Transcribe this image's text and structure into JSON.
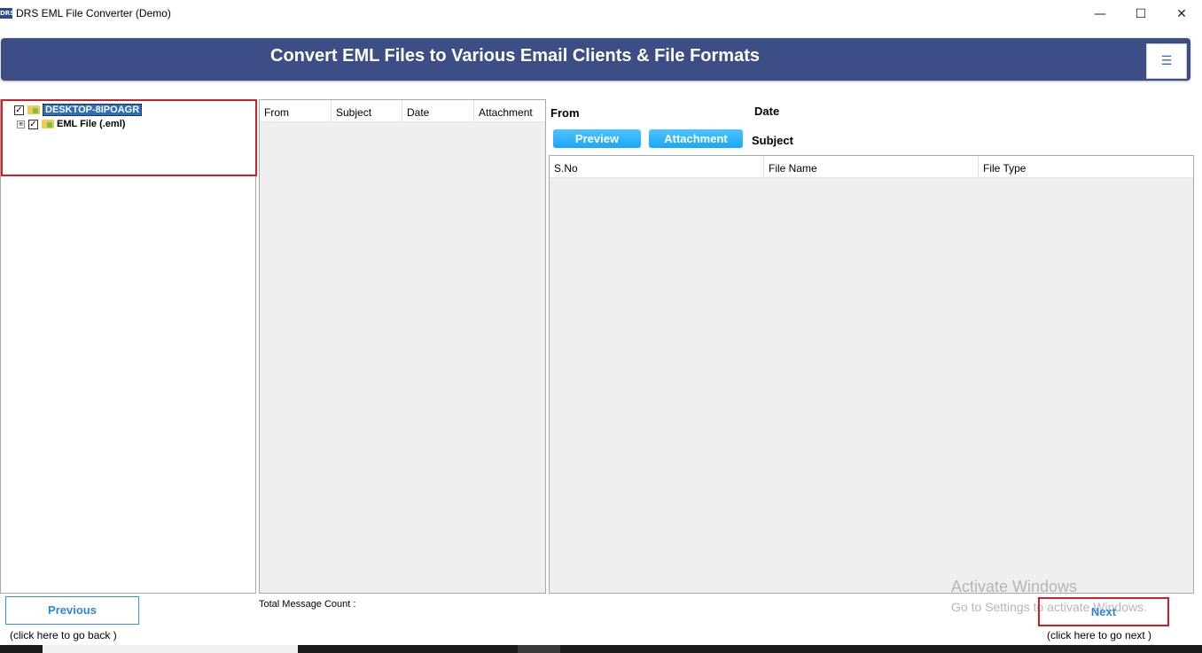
{
  "window": {
    "app_icon_text": "DRS",
    "title": "DRS EML File Converter (Demo)",
    "minimize_glyph": "—",
    "maximize_glyph": "☐",
    "close_glyph": "✕"
  },
  "banner": {
    "title": "Convert EML Files to Various Email Clients & File Formats",
    "menu_glyph": "☰",
    "background_color": "#3d4e87"
  },
  "tree": {
    "root": {
      "label": "DESKTOP-8IPOAGR",
      "checked": true,
      "expander": "⊟",
      "checkmark": "✓"
    },
    "children": [
      {
        "label": "EML File (.eml)",
        "checked": true,
        "expander": "⊞",
        "checkmark": "✓"
      }
    ]
  },
  "message_list": {
    "columns": [
      "From",
      "Subject",
      "Date",
      "Attachment"
    ],
    "total_label": "Total Message Count :"
  },
  "preview": {
    "from_label": "From",
    "date_label": "Date",
    "subject_label": "Subject",
    "preview_button": "Preview",
    "attachment_button": "Attachment",
    "attachment_columns": [
      "S.No",
      "File Name",
      "File Type"
    ]
  },
  "navigation": {
    "previous_label": "Previous",
    "previous_hint": "(click here to  go back )",
    "next_label": "Next",
    "next_hint": "(click here to  go next )"
  },
  "watermark": {
    "line1": "Activate Windows",
    "line2": "Go to Settings to activate Windows."
  },
  "colors": {
    "highlight_border": "#d11f27",
    "accent_blue": "#2e86d6",
    "button_blue": "#1aa7f7"
  }
}
